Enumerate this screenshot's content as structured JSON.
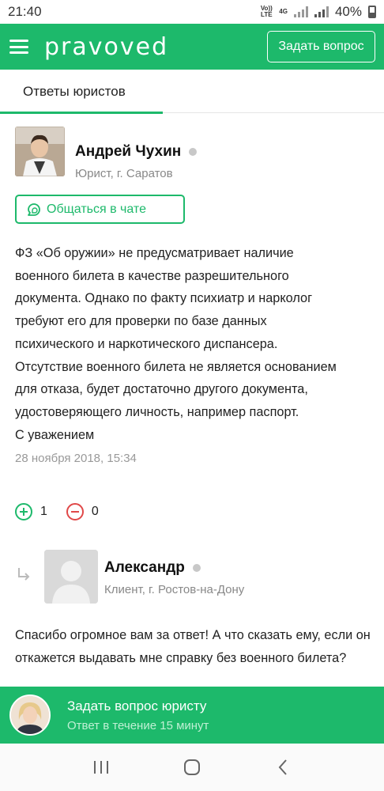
{
  "status_bar": {
    "time": "21:40",
    "volte_label": "Vo)) LTE",
    "network_label": "4G",
    "battery_percent": "40%"
  },
  "header": {
    "logo": "pravoved",
    "ask_button": "Задать вопрос"
  },
  "tabs": {
    "active_label": "Ответы юристов"
  },
  "answer": {
    "lawyer_name": "Андрей Чухин",
    "lawyer_subtitle": "Юрист, г. Саратов",
    "chat_button": "Общаться в чате",
    "text": "ФЗ «Об оружии» не предусматривает наличие\nвоенного билета  в качестве разрешительного\nдокумента. Однако по факту психиатр и нарколог\nтребуют его для проверки по базе данных\nпсихического и наркотического диспансера.\nОтсутствие военного билета не является основанием\nдля отказа, будет достаточно другого документа,\nудостоверяющего личность, например паспорт.\nС уважением",
    "date": "28 ноября 2018, 15:34",
    "upvotes": "1",
    "downvotes": "0"
  },
  "reply": {
    "author_name": "Александр",
    "author_subtitle": "Клиент, г. Ростов-на-Дону",
    "text": "Спасибо огромное вам за ответ! А что сказать ему, если он откажется выдавать мне справку без военного билета?"
  },
  "cta": {
    "title": "Задать вопрос юристу",
    "subtitle": "Ответ в течение 15 минут"
  },
  "colors": {
    "brand_green": "#1db96b",
    "downvote_red": "#e04848"
  },
  "icons": {
    "menu": "hamburger-icon",
    "chat": "chat-bubble-icon",
    "upvote": "plus-circle-icon",
    "downvote": "minus-circle-icon",
    "reply": "reply-arrow-icon",
    "nav_recents": "recents-icon",
    "nav_home": "home-icon",
    "nav_back": "back-icon"
  }
}
